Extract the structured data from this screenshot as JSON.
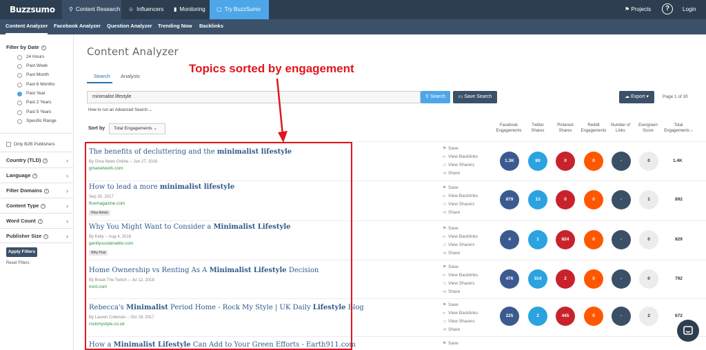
{
  "app": {
    "logo": "Buzzsumo",
    "top_nav": [
      {
        "label": "Content Research",
        "icon": "search-icon"
      },
      {
        "label": "Influencers",
        "icon": "user-icon"
      },
      {
        "label": "Monitoring",
        "icon": "bar-chart-icon"
      },
      {
        "label": "Try BuzzSumo Pro",
        "icon": "box-icon"
      }
    ],
    "projects": "Projects",
    "help": "?",
    "login": "Login",
    "sub_nav": [
      "Content Analyzer",
      "Facebook Analyzer",
      "Question Analyzer",
      "Trending Now",
      "Backlinks"
    ]
  },
  "sidebar": {
    "filter_by_date": "Filter by Date",
    "date_options": [
      "24 Hours",
      "Past Week",
      "Past Month",
      "Past 6 Months",
      "Past Year",
      "Past 2 Years",
      "Past 5 Years",
      "Specific Range"
    ],
    "selected_date": "Past Year",
    "only_b2b": "Only B2B Publishers",
    "filters": [
      "Country (TLD)",
      "Language",
      "Filter Domains",
      "Content Type",
      "Word Count",
      "Publisher Size"
    ],
    "apply": "Apply Filters",
    "reset": "Reset Filters"
  },
  "main": {
    "title": "Content Analyzer",
    "tabs": [
      "Search",
      "Analysis"
    ],
    "search_value": "minimalist lifestyle",
    "search_button": "Search",
    "save_search": "Save Search",
    "advanced_link": "How to run an Advanced Search",
    "export": "Export",
    "page_info": "Page 1 of 30",
    "sort_by": "Sort by",
    "sort_value": "Total Engagements",
    "columns": [
      "Facebook Engagements",
      "Twitter Shares",
      "Pinterest Shares",
      "Reddit Engagements",
      "Number of Links",
      "Evergreen Score",
      "Total Engagements"
    ],
    "actions": [
      "Save",
      "View Backlinks",
      "View Sharers",
      "Share"
    ],
    "rows": [
      {
        "title_pre": "The benefits of decluttering and the ",
        "title_bold": "minimalist lifestyle",
        "title_post": "",
        "meta": "By Gma News Online -- Jun 27, 2018",
        "domain": "gmanetwork.com",
        "tag": "",
        "fb": "1.3K",
        "tw": "89",
        "pi": "0",
        "rd": "0",
        "ln": "-",
        "ev": "0",
        "total": "1.4K"
      },
      {
        "title_pre": "How to lead a more ",
        "title_bold": "minimalist lifestyle",
        "title_post": "",
        "meta": "Sep 30, 2017",
        "domain": "fluxmagazine.com",
        "tag": "How Article",
        "fb": "879",
        "tw": "13",
        "pi": "0",
        "rd": "0",
        "ln": "-",
        "ev": "1",
        "total": "892"
      },
      {
        "title_pre": "Why You Might Want to Consider a ",
        "title_bold": "Minimalist Lifestyle",
        "title_post": "",
        "meta": "By Kelly -- Aug 4, 2018",
        "domain": "gentlysustainable.com",
        "tag": "Why Post",
        "fb": "4",
        "tw": "1",
        "pi": "824",
        "rd": "0",
        "ln": "-",
        "ev": "0",
        "total": "829"
      },
      {
        "title_pre": "Home Ownership vs Renting As A ",
        "title_bold": "Minimalist Lifestyle",
        "title_post": " Decision",
        "meta": "By Break The Twitch -- Jul 12, 2018",
        "domain": "mint.com",
        "tag": "",
        "fb": "476",
        "tw": "314",
        "pi": "2",
        "rd": "0",
        "ln": "-",
        "ev": "0",
        "total": "792"
      },
      {
        "title_pre": "Rebecca's ",
        "title_bold": "Minimalist",
        "title_mid": " Period Home - Rock My Style | UK Daily ",
        "title_bold2": "Lifestyle",
        "title_post": " Blog",
        "meta": "By Lauren Coleman -- Oct 19, 2017",
        "domain": "rockmystyle.co.uk",
        "tag": "",
        "fb": "225",
        "tw": "2",
        "pi": "445",
        "rd": "0",
        "ln": "-",
        "ev": "2",
        "total": "672"
      },
      {
        "title_pre": "How a ",
        "title_bold": "Minimalist Lifestyle",
        "title_post": " Can Add to Your Green Efforts - Earth911.com",
        "meta": "",
        "domain": "",
        "tag": ""
      }
    ]
  },
  "annotation": {
    "text": "Topics sorted by engagement",
    "color": "#e0161c"
  },
  "colors": {
    "nav": "#2d3e50",
    "accent": "#4da6e8",
    "facebook": "#3b5a8f",
    "twitter": "#2aa3e0",
    "pinterest": "#c8232c",
    "reddit": "#ff5700"
  }
}
